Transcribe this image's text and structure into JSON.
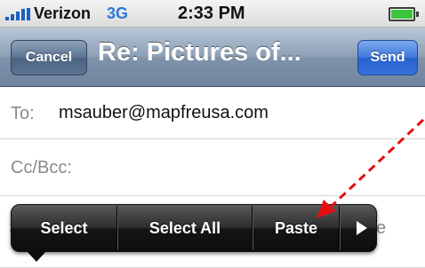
{
  "status_bar": {
    "carrier": "Verizon",
    "network": "3G",
    "time": "2:33 PM",
    "signal_icon": "signal-bars-icon",
    "battery_icon": "battery-icon"
  },
  "nav_bar": {
    "cancel_label": "Cancel",
    "title": "Re: Pictures of...",
    "send_label": "Send"
  },
  "fields": {
    "to_label": "To:",
    "to_value": "msauber@mapfreusa.com",
    "cc_label": "Cc/Bcc:"
  },
  "edit_menu": {
    "items": [
      "Select",
      "Select All",
      "Paste"
    ],
    "more_icon": "play-arrow-icon"
  },
  "colors": {
    "send_button": "#2562cf",
    "annotation_arrow": "#e01010"
  }
}
